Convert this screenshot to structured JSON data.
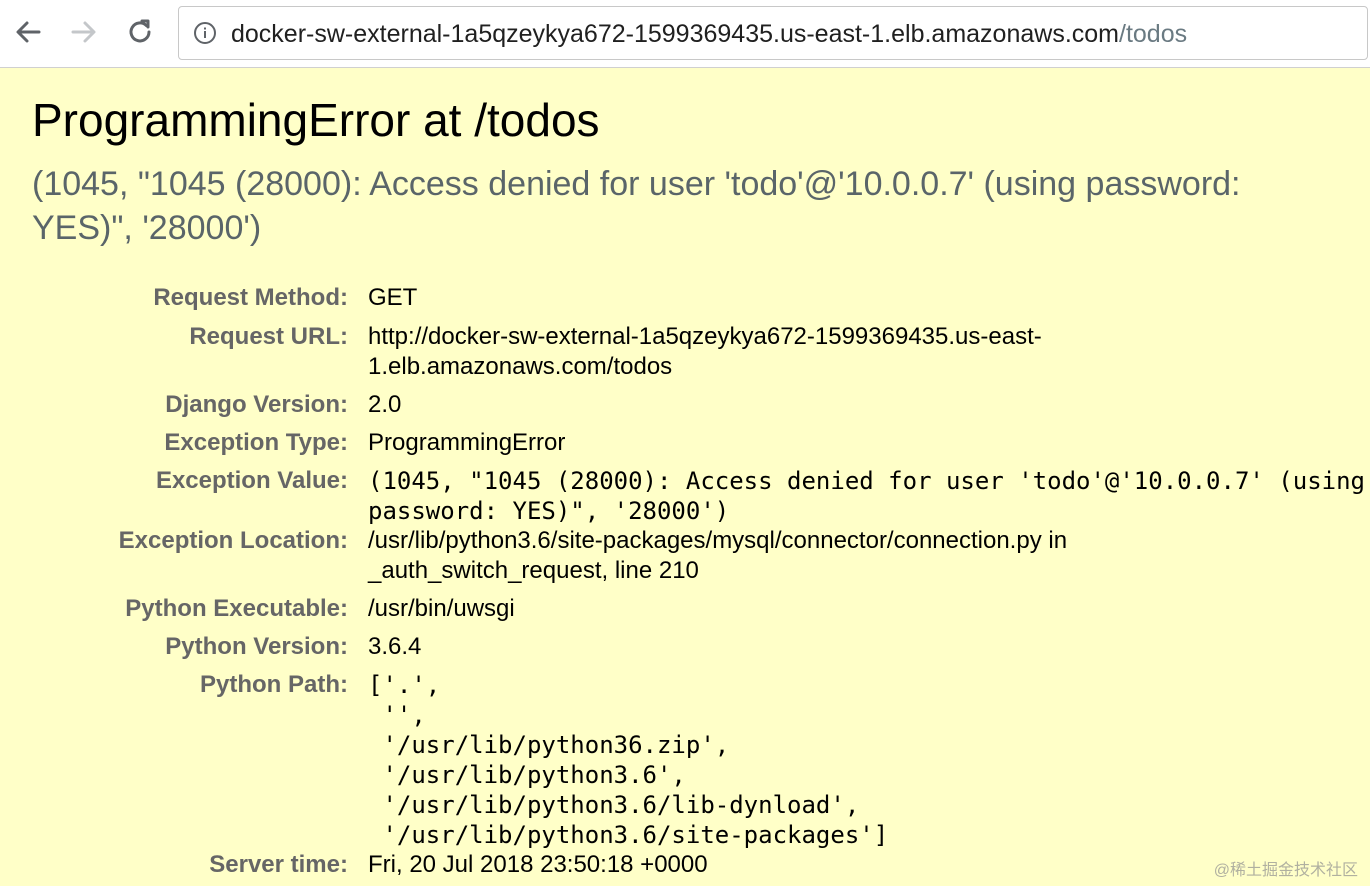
{
  "browser": {
    "url_host": "docker-sw-external-1a5qzeykya672-1599369435.us-east-1.elb.amazonaws.com",
    "url_path": "/todos"
  },
  "summary": {
    "title": "ProgrammingError at /todos",
    "subtitle": "(1045, \"1045 (28000): Access denied for user 'todo'@'10.0.0.7' (using password: YES)\", '28000')"
  },
  "meta": {
    "request_method": {
      "label": "Request Method:",
      "value": "GET"
    },
    "request_url": {
      "label": "Request URL:",
      "value_line1": "http://docker-sw-external-1a5qzeykya672-1599369435.us-east-",
      "value_line2": "1.elb.amazonaws.com/todos"
    },
    "django_version": {
      "label": "Django Version:",
      "value": "2.0"
    },
    "exception_type": {
      "label": "Exception Type:",
      "value": "ProgrammingError"
    },
    "exception_value": {
      "label": "Exception Value:",
      "value_line1": "(1045, \"1045 (28000): Access denied for user 'todo'@'10.0.0.7' (using",
      "value_line2": "password: YES)\", '28000')"
    },
    "exception_location": {
      "label": "Exception Location:",
      "value_line1": "/usr/lib/python3.6/site-packages/mysql/connector/connection.py in",
      "value_line2": "_auth_switch_request, line 210"
    },
    "python_executable": {
      "label": "Python Executable:",
      "value": "/usr/bin/uwsgi"
    },
    "python_version": {
      "label": "Python Version:",
      "value": "3.6.4"
    },
    "python_path": {
      "label": "Python Path:",
      "lines": [
        "['.',",
        " '',",
        " '/usr/lib/python36.zip',",
        " '/usr/lib/python3.6',",
        " '/usr/lib/python3.6/lib-dynload',",
        " '/usr/lib/python3.6/site-packages']"
      ]
    },
    "server_time": {
      "label": "Server time:",
      "value": "Fri, 20 Jul 2018 23:50:18 +0000"
    }
  },
  "watermark": "@稀土掘金技术社区"
}
